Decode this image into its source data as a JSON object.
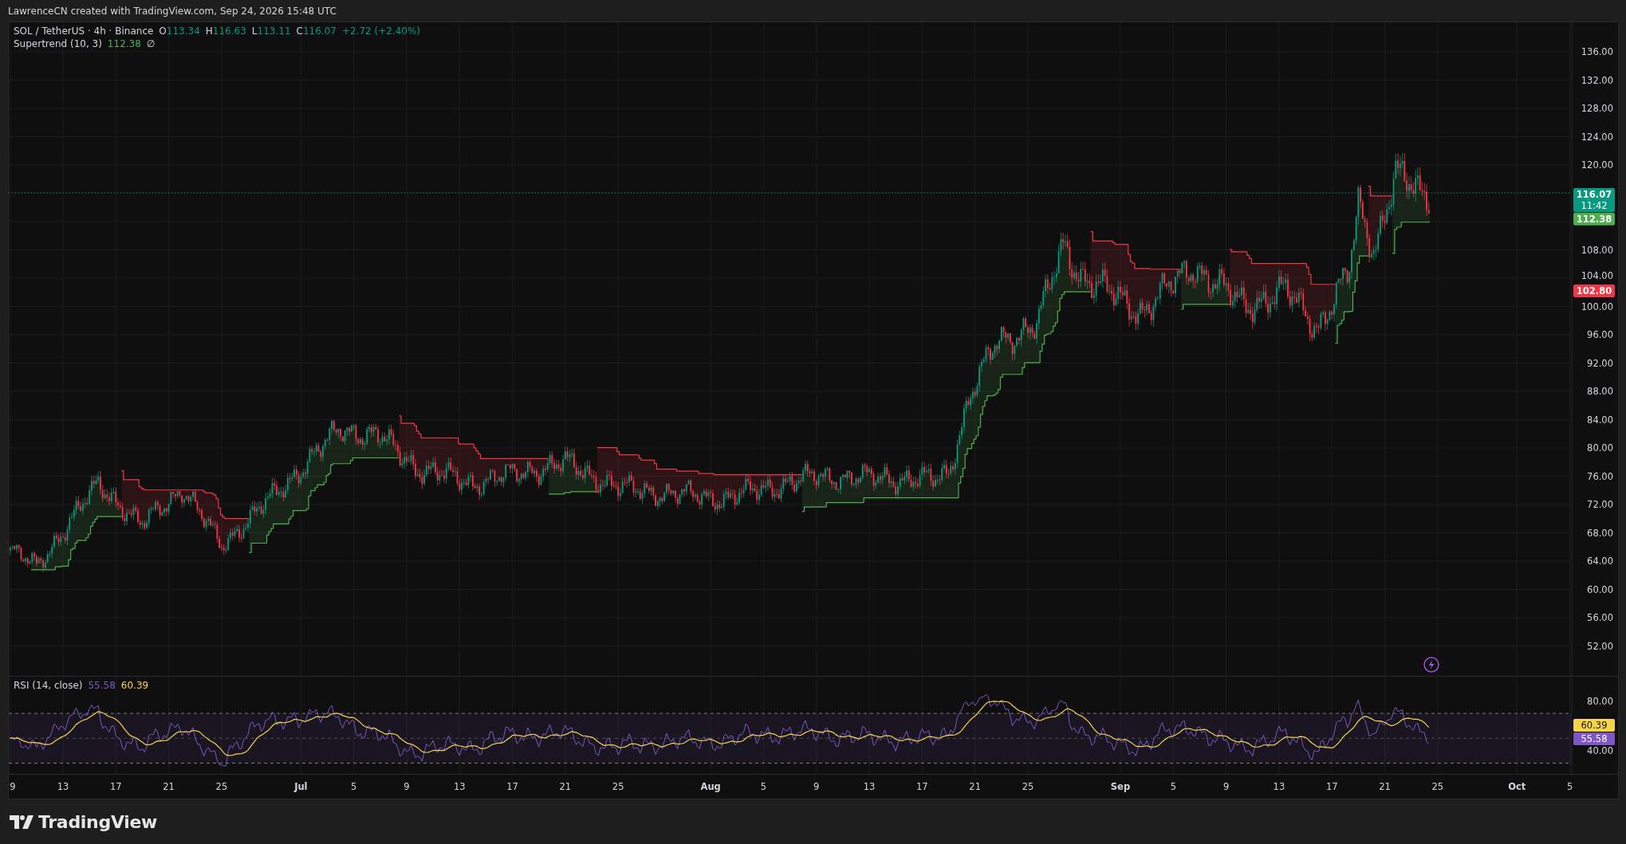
{
  "attribution": "LawrenceCN created with TradingView.com, Sep 24, 2026 15:48 UTC",
  "legend": {
    "symbol": "SOL / TetherUS · 4h · Binance",
    "ohlc": [
      {
        "key": "O",
        "value": "113.34"
      },
      {
        "key": "H",
        "value": "116.63"
      },
      {
        "key": "L",
        "value": "113.11"
      },
      {
        "key": "C",
        "value": "116.07"
      }
    ],
    "change": "+2.72 (+2.40%)"
  },
  "indicator": {
    "name": "Supertrend (10, 3)",
    "value": "112.38",
    "extra": "∅"
  },
  "price_axis": {
    "labels": [
      "136.00",
      "132.00",
      "128.00",
      "124.00",
      "120.00",
      "108.00",
      "104.00",
      "100.00",
      "96.00",
      "92.00",
      "88.00",
      "84.00",
      "80.00",
      "76.00",
      "72.00",
      "68.00",
      "64.00",
      "60.00",
      "56.00",
      "52.00"
    ],
    "badges": [
      {
        "kind": "last",
        "value": "116.07",
        "countdown": "11:42"
      },
      {
        "kind": "up",
        "value": "112.38"
      },
      {
        "kind": "down",
        "value": "102.80"
      }
    ]
  },
  "rsi": {
    "title": "RSI (14, close)",
    "value": "55.58",
    "ma": "60.39",
    "axis_labels": [
      "80.00",
      "40.00"
    ],
    "badges": [
      {
        "kind": "ma",
        "value": "60.39"
      },
      {
        "kind": "value",
        "value": "55.58"
      }
    ]
  },
  "time_axis": {
    "labels": [
      {
        "label": "9",
        "kind": "day"
      },
      {
        "label": "13",
        "kind": "day"
      },
      {
        "label": "17",
        "kind": "day"
      },
      {
        "label": "21",
        "kind": "day"
      },
      {
        "label": "25",
        "kind": "day"
      },
      {
        "label": "Jul",
        "kind": "month"
      },
      {
        "label": "5",
        "kind": "day"
      },
      {
        "label": "9",
        "kind": "day"
      },
      {
        "label": "13",
        "kind": "day"
      },
      {
        "label": "17",
        "kind": "day"
      },
      {
        "label": "21",
        "kind": "day"
      },
      {
        "label": "25",
        "kind": "day"
      },
      {
        "label": "Aug",
        "kind": "month"
      },
      {
        "label": "5",
        "kind": "day"
      },
      {
        "label": "9",
        "kind": "day"
      },
      {
        "label": "13",
        "kind": "day"
      },
      {
        "label": "17",
        "kind": "day"
      },
      {
        "label": "21",
        "kind": "day"
      },
      {
        "label": "25",
        "kind": "day"
      },
      {
        "label": "Sep",
        "kind": "month"
      },
      {
        "label": "5",
        "kind": "day"
      },
      {
        "label": "9",
        "kind": "day"
      },
      {
        "label": "13",
        "kind": "day"
      },
      {
        "label": "17",
        "kind": "day"
      },
      {
        "label": "21",
        "kind": "day"
      },
      {
        "label": "25",
        "kind": "day"
      },
      {
        "label": "Oct",
        "kind": "month"
      },
      {
        "label": "5",
        "kind": "day"
      }
    ]
  },
  "brand": "TradingView"
}
